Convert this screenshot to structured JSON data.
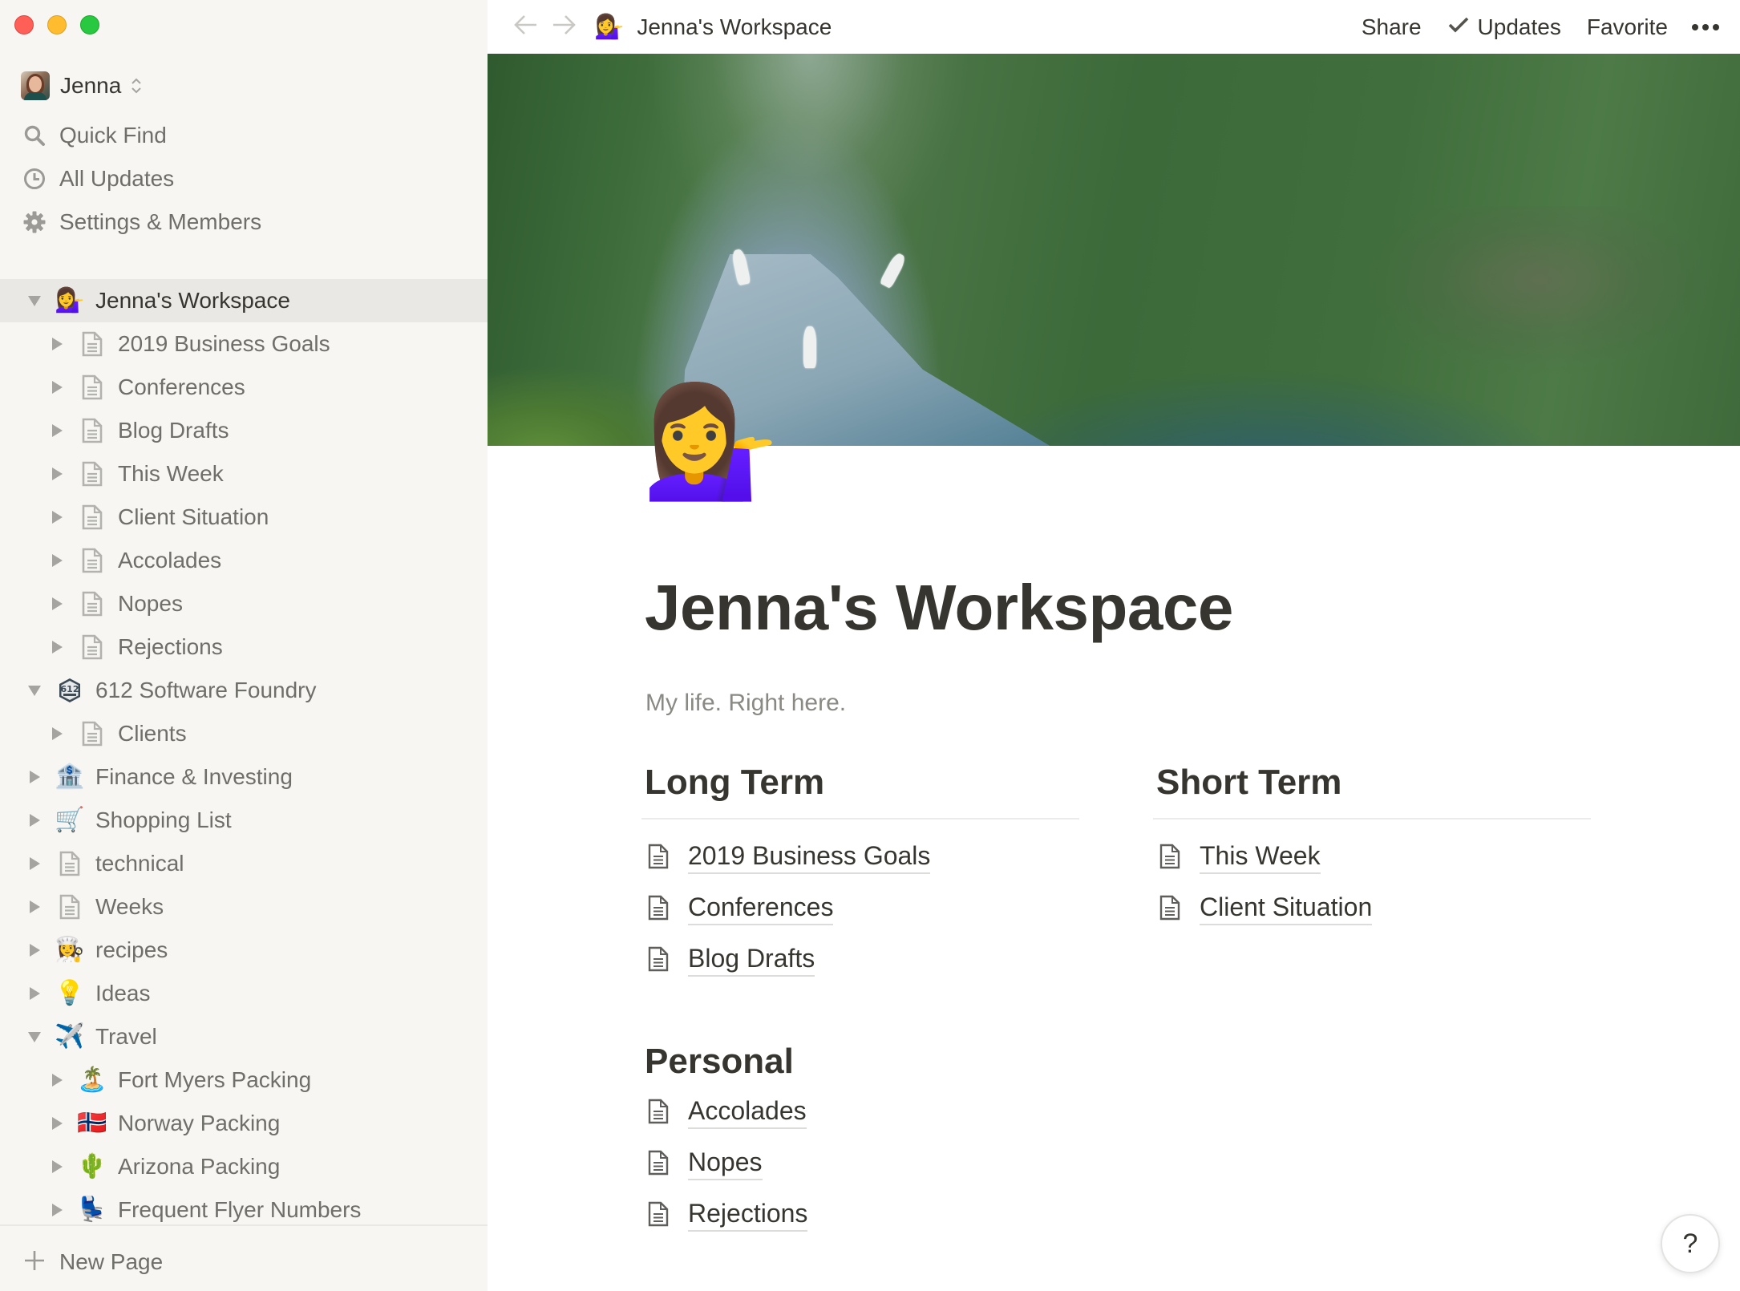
{
  "window": {
    "controls": [
      "close",
      "minimize",
      "zoom"
    ]
  },
  "sidebar": {
    "workspace": {
      "name": "Jenna",
      "avatar": "user-avatar-photo"
    },
    "nav": [
      {
        "label": "Quick Find",
        "icon": "search-icon"
      },
      {
        "label": "All Updates",
        "icon": "clock-icon"
      },
      {
        "label": "Settings & Members",
        "icon": "gear-icon"
      }
    ],
    "tree": [
      {
        "label": "Jenna's Workspace",
        "icon": "💁‍♀️",
        "icon_name": "woman-tipping-hand-icon",
        "level": 0,
        "expanded": true,
        "selected": true
      },
      {
        "label": "2019 Business Goals",
        "icon": "page",
        "icon_name": "page-icon",
        "level": 1,
        "expanded": false
      },
      {
        "label": "Conferences",
        "icon": "page",
        "icon_name": "page-icon",
        "level": 1,
        "expanded": false
      },
      {
        "label": "Blog Drafts",
        "icon": "page",
        "icon_name": "page-icon",
        "level": 1,
        "expanded": false
      },
      {
        "label": "This Week",
        "icon": "page",
        "icon_name": "page-icon",
        "level": 1,
        "expanded": false
      },
      {
        "label": "Client Situation",
        "icon": "page",
        "icon_name": "page-icon",
        "level": 1,
        "expanded": false
      },
      {
        "label": "Accolades",
        "icon": "page",
        "icon_name": "page-icon",
        "level": 1,
        "expanded": false
      },
      {
        "label": "Nopes",
        "icon": "page",
        "icon_name": "page-icon",
        "level": 1,
        "expanded": false
      },
      {
        "label": "Rejections",
        "icon": "page",
        "icon_name": "page-icon",
        "level": 1,
        "expanded": false
      },
      {
        "label": "612 Software Foundry",
        "icon": "612",
        "icon_name": "612-foundry-logo-icon",
        "level": 0,
        "expanded": true
      },
      {
        "label": "Clients",
        "icon": "page",
        "icon_name": "page-icon",
        "level": 1,
        "expanded": false
      },
      {
        "label": "Finance & Investing",
        "icon": "🏦",
        "icon_name": "bank-icon",
        "level": 0,
        "expanded": false
      },
      {
        "label": "Shopping List",
        "icon": "🛒",
        "icon_name": "shopping-cart-icon",
        "level": 0,
        "expanded": false
      },
      {
        "label": "technical",
        "icon": "page",
        "icon_name": "page-icon",
        "level": 0,
        "expanded": false
      },
      {
        "label": "Weeks",
        "icon": "page",
        "icon_name": "page-icon",
        "level": 0,
        "expanded": false
      },
      {
        "label": "recipes",
        "icon": "👩‍🍳",
        "icon_name": "woman-cook-icon",
        "level": 0,
        "expanded": false
      },
      {
        "label": "Ideas",
        "icon": "💡",
        "icon_name": "light-bulb-icon",
        "level": 0,
        "expanded": false
      },
      {
        "label": "Travel",
        "icon": "✈️",
        "icon_name": "airplane-icon",
        "level": 0,
        "expanded": true
      },
      {
        "label": "Fort Myers Packing",
        "icon": "🏝️",
        "icon_name": "beach-umbrella-island-icon",
        "level": 1,
        "expanded": false
      },
      {
        "label": "Norway Packing",
        "icon": "🇳🇴",
        "icon_name": "norway-flag-icon",
        "level": 1,
        "expanded": false
      },
      {
        "label": "Arizona Packing",
        "icon": "🌵",
        "icon_name": "cactus-icon",
        "level": 1,
        "expanded": false
      },
      {
        "label": "Frequent Flyer Numbers",
        "icon": "💺",
        "icon_name": "seat-icon",
        "level": 1,
        "expanded": false
      }
    ],
    "new_page_label": "New Page"
  },
  "topbar": {
    "breadcrumb": {
      "icon": "💁‍♀️",
      "title": "Jenna's Workspace"
    },
    "actions": {
      "share": "Share",
      "updates": "Updates",
      "favorite": "Favorite"
    }
  },
  "page": {
    "icon": "💁‍♀️",
    "title": "Jenna's Workspace",
    "subtitle": "My life. Right here.",
    "cover": "norway-fjord-photo",
    "sections": {
      "long_term": {
        "heading": "Long Term",
        "links": [
          "2019 Business Goals",
          "Conferences",
          "Blog Drafts"
        ]
      },
      "short_term": {
        "heading": "Short Term",
        "links": [
          "This Week",
          "Client Situation"
        ]
      },
      "personal": {
        "heading": "Personal",
        "links": [
          "Accolades",
          "Nopes",
          "Rejections"
        ]
      }
    }
  },
  "help": {
    "label": "?"
  }
}
